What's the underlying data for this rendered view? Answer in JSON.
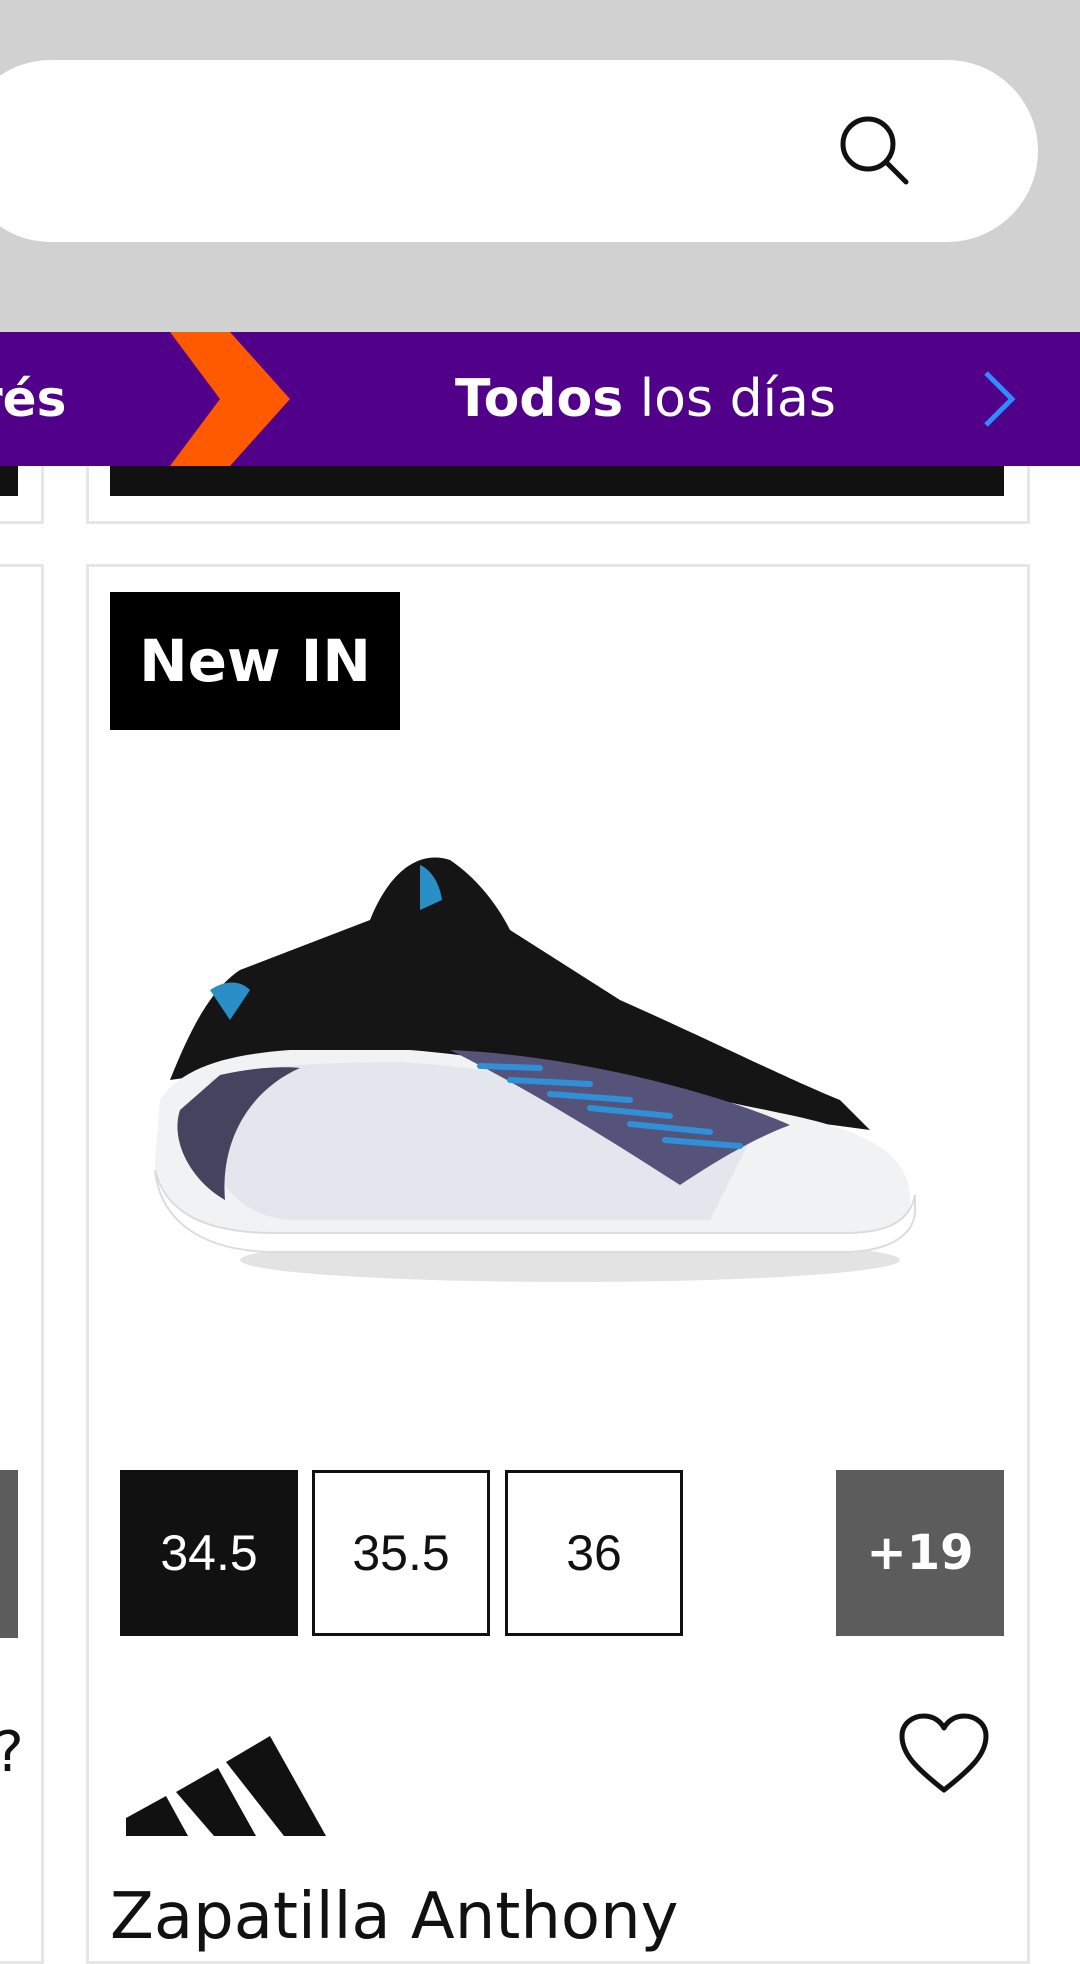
{
  "search": {
    "value": "",
    "placeholder": ""
  },
  "promo": {
    "left_text": "rés",
    "right_strong": "Todos",
    "right_text": " los días"
  },
  "product": {
    "badge": "New IN",
    "sizes": [
      "34.5",
      "35.5",
      "36"
    ],
    "more_sizes": "+19",
    "title": "Zapatilla Anthony"
  },
  "left_fragment": {
    "text": "?"
  },
  "colors": {
    "banner": "#51008a",
    "orange": "#ff5a00",
    "next_arrow": "#2f8cff"
  }
}
